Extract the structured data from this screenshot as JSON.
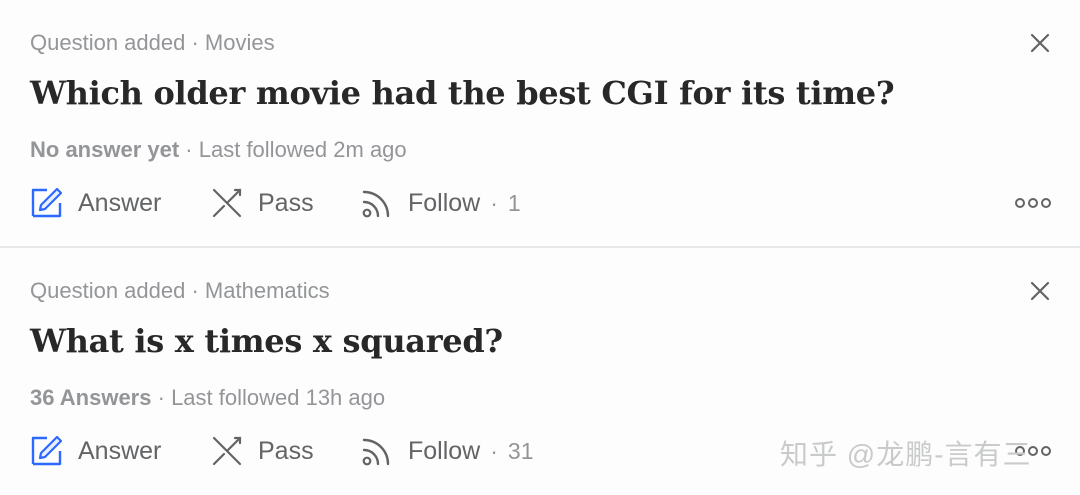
{
  "feed": {
    "items": [
      {
        "meta_prefix": "Question added",
        "separator": "·",
        "topic": "Movies",
        "title": "Which older movie had the best CGI for its time?",
        "answers_label": "No answer yet",
        "followed_label": "Last followed 2m ago",
        "actions": {
          "answer": "Answer",
          "pass": "Pass",
          "follow": "Follow",
          "follow_count": "1"
        },
        "icons": [
          "close-icon",
          "pencil-icon",
          "pass-icon",
          "follow-icon",
          "more-icon"
        ]
      },
      {
        "meta_prefix": "Question added",
        "separator": "·",
        "topic": "Mathematics",
        "title": "What is x times x squared?",
        "answers_label": "36 Answers",
        "followed_label": "Last followed 13h ago",
        "actions": {
          "answer": "Answer",
          "pass": "Pass",
          "follow": "Follow",
          "follow_count": "31"
        },
        "icons": [
          "close-icon",
          "pencil-icon",
          "pass-icon",
          "follow-icon",
          "more-icon"
        ]
      }
    ]
  },
  "watermark": "知乎 @龙鹏-言有三",
  "colors": {
    "answer_icon": "#2e69ff",
    "text_primary": "#282829",
    "text_secondary": "#939598",
    "action_text": "#636466"
  }
}
